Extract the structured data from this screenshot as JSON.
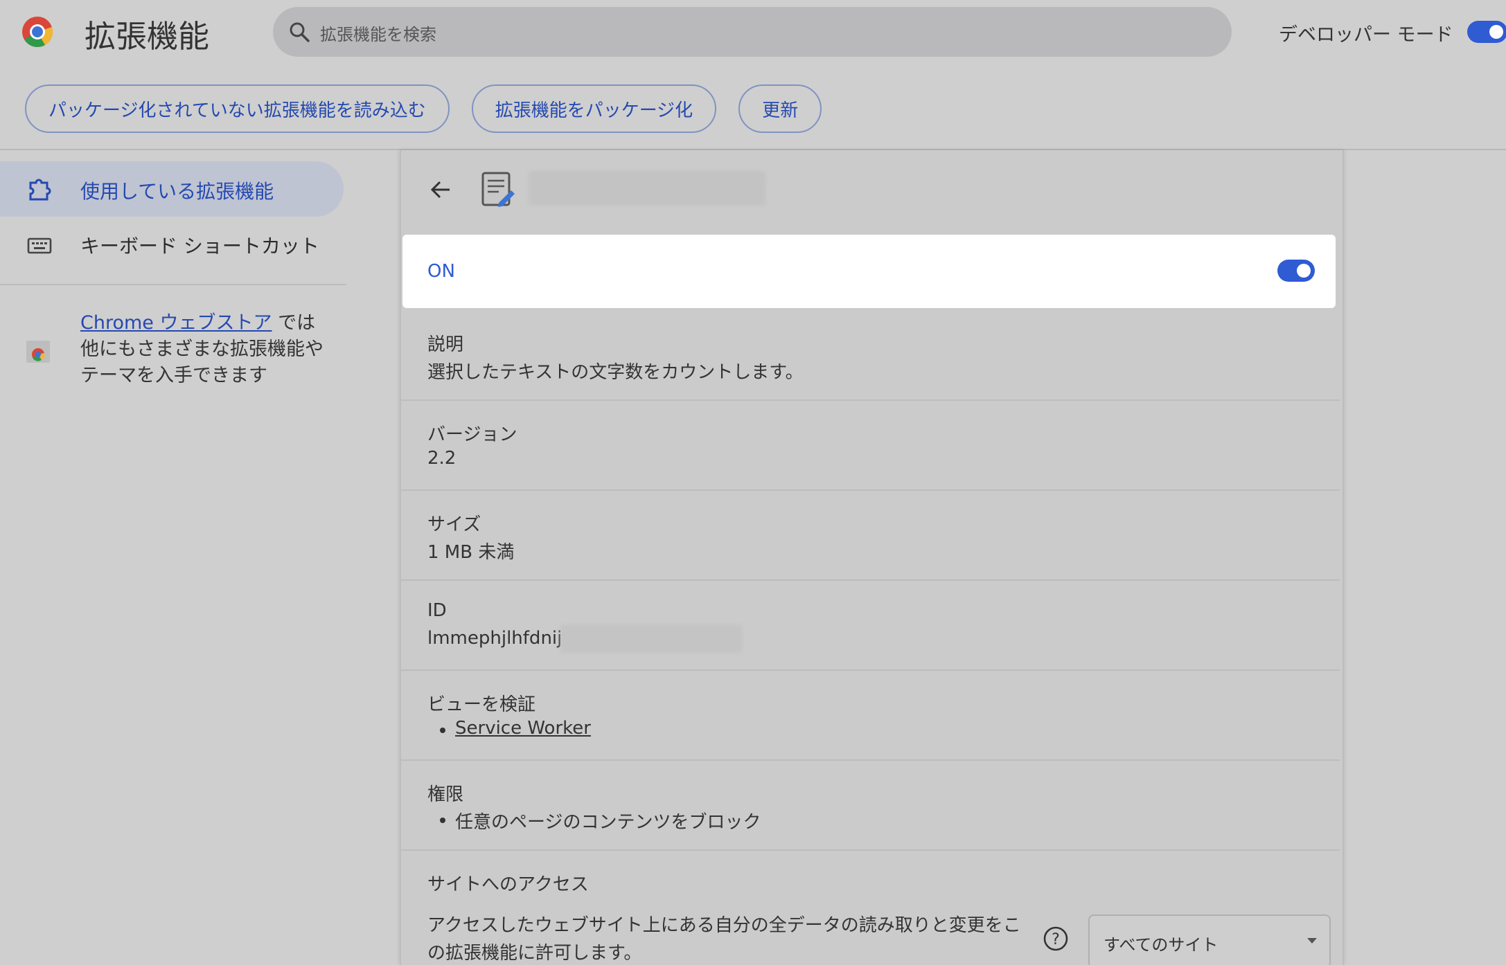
{
  "header": {
    "title": "拡張機能",
    "search_placeholder": "拡張機能を検索",
    "developer_mode_label": "デベロッパー モード",
    "developer_mode_on": true
  },
  "toolbar": {
    "load_unpacked": "パッケージ化されていない拡張機能を読み込む",
    "pack_extension": "拡張機能をパッケージ化",
    "update": "更新"
  },
  "sidebar": {
    "items": [
      {
        "label": "使用している拡張機能",
        "icon": "puzzle-icon",
        "active": true
      },
      {
        "label": "キーボード ショートカット",
        "icon": "keyboard-icon",
        "active": false
      }
    ],
    "store_link": "Chrome ウェブストア",
    "store_text": " では他にもさまざまな拡張機能やテーマを入手できます"
  },
  "detail": {
    "on_label": "ON",
    "enabled": true,
    "description": {
      "title": "説明",
      "value": "選択したテキストの文字数をカウントします。"
    },
    "version": {
      "title": "バージョン",
      "value": "2.2"
    },
    "size": {
      "title": "サイズ",
      "value": "1 MB 未満"
    },
    "id": {
      "title": "ID",
      "value": "lmmephjlhfdnijfi"
    },
    "inspect": {
      "title": "ビューを検証",
      "link": "Service Worker"
    },
    "permissions": {
      "title": "権限",
      "items": [
        "任意のページのコンテンツをブロック"
      ]
    },
    "site_access": {
      "title": "サイトへのアクセス",
      "description": "アクセスしたウェブサイト上にある自分の全データの読み取りと変更をこの拡張機能に許可します。",
      "selected": "すべてのサイト"
    }
  },
  "colors": {
    "accent": "#2f5bd3",
    "link": "#2449b0",
    "background": "#cfcfcf"
  }
}
